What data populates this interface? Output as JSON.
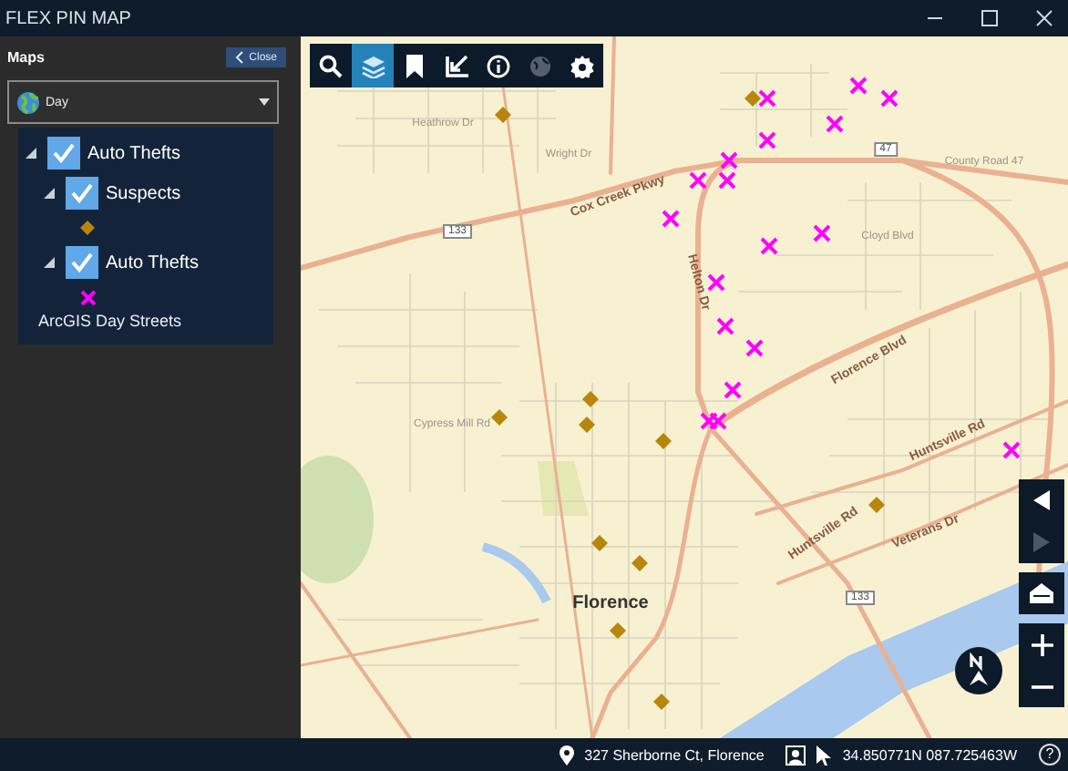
{
  "window": {
    "title": "FLEX PIN MAP"
  },
  "panel": {
    "title": "Maps",
    "close_button": "Close",
    "basemap_select": {
      "value": "Day"
    },
    "layers": [
      {
        "label": "Auto Thefts",
        "checked": true,
        "expanded": true,
        "children": [
          {
            "label": "Suspects",
            "checked": true,
            "expanded": true,
            "legend": {
              "kind": "diamond",
              "color": "#b8860b"
            }
          },
          {
            "label": "Auto Thefts",
            "checked": true,
            "expanded": true,
            "legend": {
              "kind": "cross",
              "color": "#ff00ff"
            }
          }
        ]
      }
    ],
    "basemap_label": "ArcGIS Day Streets"
  },
  "toolbar": [
    {
      "kind": "search",
      "selected": false,
      "disabled": false
    },
    {
      "kind": "layers",
      "selected": true,
      "disabled": false
    },
    {
      "kind": "bookmark",
      "selected": false,
      "disabled": false
    },
    {
      "kind": "corner-arrow",
      "selected": false,
      "disabled": false
    },
    {
      "kind": "info",
      "selected": false,
      "disabled": false
    },
    {
      "kind": "globe",
      "selected": false,
      "disabled": true
    },
    {
      "kind": "settings",
      "selected": false,
      "disabled": false
    }
  ],
  "map": {
    "labels": [
      "Heathrow Dr",
      "Wright Dr",
      "Cox Creek Pkwy",
      "133",
      "47",
      "County Road 47",
      "Cloyd Blvd",
      "Helton Dr",
      "Florence Blvd",
      "Cypress Mill Rd",
      "Huntsville Rd",
      "Huntsville Rd",
      "Veterans Dr",
      "Florence",
      "133"
    ],
    "nav": [
      {
        "kind": "back",
        "disabled": false
      },
      {
        "kind": "forward",
        "disabled": true
      },
      {
        "kind": "home",
        "disabled": false
      },
      {
        "kind": "zoom-in",
        "disabled": false
      },
      {
        "kind": "zoom-out",
        "disabled": false
      }
    ]
  },
  "status_bar": {
    "address": "327 Sherborne Ct, Florence",
    "coordinates": "34.850771N 087.725463W",
    "help_button": "?"
  }
}
